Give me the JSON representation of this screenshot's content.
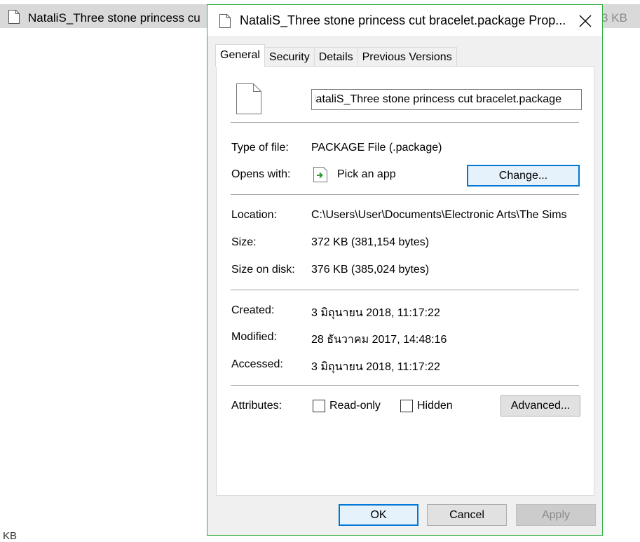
{
  "explorer": {
    "file_name": "NataliS_Three stone princess cu",
    "file_size": "3 KB",
    "bottom_text": "KB"
  },
  "dialog": {
    "title": "NataliS_Three stone princess cut bracelet.package Prop...",
    "tabs": [
      {
        "label": "General",
        "active": true
      },
      {
        "label": "Security",
        "active": false
      },
      {
        "label": "Details",
        "active": false
      },
      {
        "label": "Previous Versions",
        "active": false
      }
    ],
    "file_name_value": "NataliS_Three stone princess cut bracelet.package",
    "type_label": "Type of file:",
    "type_value": "PACKAGE File (.package)",
    "opens_label": "Opens with:",
    "opens_value": "Pick an app",
    "change_button": "Change...",
    "location_label": "Location:",
    "location_value": "C:\\Users\\User\\Documents\\Electronic Arts\\The Sims",
    "size_label": "Size:",
    "size_value": "372 KB (381,154 bytes)",
    "size_on_disk_label": "Size on disk:",
    "size_on_disk_value": "376 KB (385,024 bytes)",
    "created_label": "Created:",
    "created_value": "3 มิถุนายน 2018, 11:17:22",
    "modified_label": "Modified:",
    "modified_value": "28 ธันวาคม 2017, 14:48:16",
    "accessed_label": "Accessed:",
    "accessed_value": "3 มิถุนายน 2018, 11:17:22",
    "attributes_label": "Attributes:",
    "readonly_label": "Read-only",
    "readonly_checked": false,
    "hidden_label": "Hidden",
    "hidden_checked": false,
    "advanced_button": "Advanced...",
    "ok_button": "OK",
    "cancel_button": "Cancel",
    "apply_button": "Apply"
  },
  "icons": {
    "file": "file-icon",
    "close": "close-icon",
    "app": "pick-app-icon"
  },
  "colors": {
    "focus_border": "#0078d7",
    "dialog_border": "#35b04a",
    "app_icon_arrow": "#2e9a36"
  }
}
